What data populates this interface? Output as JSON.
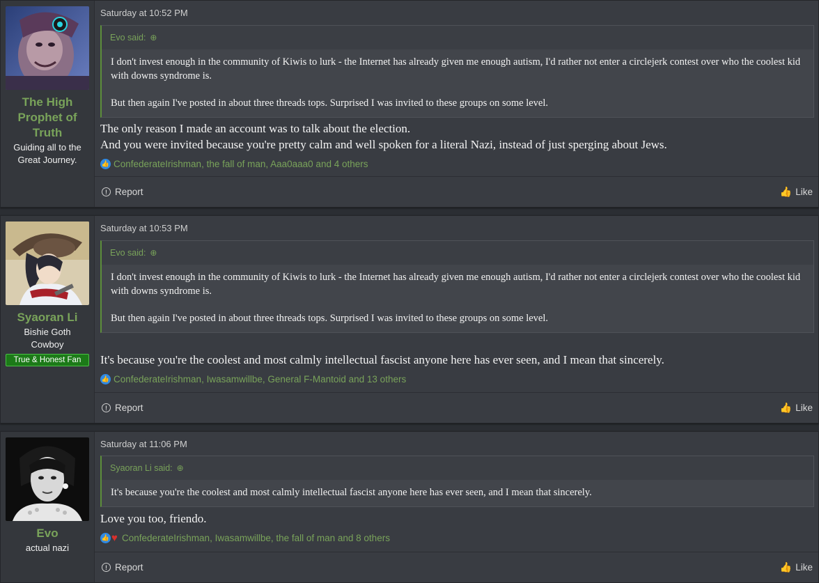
{
  "posts": [
    {
      "user": {
        "name": "The High Prophet of Truth",
        "title": "Guiding all to the Great Journey.",
        "avatar": "prophet-avatar"
      },
      "date": "Saturday at 10:52 PM",
      "quote": {
        "author": "Evo said:",
        "paragraphs": [
          "I don't invest enough in the community of Kiwis to lurk - the Internet has already given me enough autism, I'd rather not enter a circlejerk contest over who the coolest kid with downs syndrome is.",
          "But then again I've posted in about three threads tops. Surprised I was invited to these groups on some level."
        ]
      },
      "body": [
        "The only reason I made an account was to talk about the election.",
        "And you were invited because you're pretty calm and well spoken for a literal Nazi, instead of just sperging about Jews."
      ],
      "reactions": "ConfederateIrishman, the fall of man, Aaa0aaa0 and 4 others",
      "report_label": "Report",
      "like_label": "Like"
    },
    {
      "user": {
        "name": "Syaoran Li",
        "title": "Bishie Goth Cowboy",
        "banner": "True & Honest Fan",
        "avatar": "cowboy-avatar"
      },
      "date": "Saturday at 10:53 PM",
      "quote": {
        "author": "Evo said:",
        "paragraphs": [
          "I don't invest enough in the community of Kiwis to lurk - the Internet has already given me enough autism, I'd rather not enter a circlejerk contest over who the coolest kid with downs syndrome is.",
          "But then again I've posted in about three threads tops. Surprised I was invited to these groups on some level."
        ]
      },
      "body": [
        "It's because you're the coolest and most calmly intellectual fascist anyone here has ever seen, and I mean that sincerely."
      ],
      "reactions": "ConfederateIrishman, Iwasamwillbe, General F-Mantoid and 13 others",
      "report_label": "Report",
      "like_label": "Like"
    },
    {
      "user": {
        "name": "Evo",
        "title": "actual nazi",
        "avatar": "portrait-avatar"
      },
      "date": "Saturday at 11:06 PM",
      "quote": {
        "author": "Syaoran Li said:",
        "paragraphs": [
          "It's because you're the coolest and most calmly intellectual fascist anyone here has ever seen, and I mean that sincerely."
        ]
      },
      "body": [
        "Love you too, friendo."
      ],
      "reactions": "ConfederateIrishman, Iwasamwillbe, the fall of man and 8 others",
      "report_label": "Report",
      "like_label": "Like"
    }
  ],
  "colors": {
    "accent": "#79a35a",
    "banner": "#1c7a18",
    "like_reaction": "#2f8ae5",
    "love_reaction": "#d9302c"
  },
  "icons": {
    "quote_jump": "arrow-up-circle-icon",
    "report": "info-circle-icon",
    "like": "thumbs-up-icon"
  }
}
